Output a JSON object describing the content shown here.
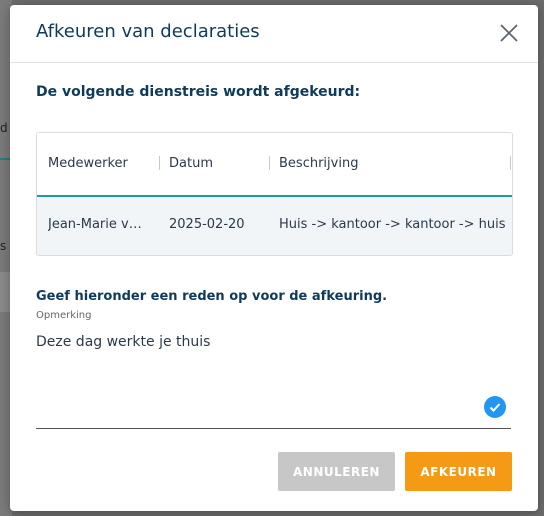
{
  "background": {
    "text1": "d",
    "text2": "s"
  },
  "dialog": {
    "title": "Afkeuren van declaraties",
    "close_icon": "close-icon",
    "subtitle": "De volgende dienstreis wordt afgekeurd:",
    "grid": {
      "columns": [
        "Medewerker",
        "Datum",
        "Beschrijving"
      ],
      "rows": [
        {
          "medewerker": "Jean-Marie va...",
          "datum": "2025-02-20",
          "beschrijving": "Huis -> kantoor -> kantoor -> huis"
        }
      ]
    },
    "reason": {
      "label": "Geef hieronder een reden op voor de afkeuring.",
      "field_label": "Opmerking",
      "value": "Deze dag werkte je thuis",
      "valid_icon": "check-circle-icon"
    },
    "buttons": {
      "cancel": "ANNULEREN",
      "reject": "AFKEUREN"
    }
  },
  "colors": {
    "accent": "#f59a14",
    "title": "#0e3b5a",
    "grid_line": "#1e9aa0",
    "check": "#2196f3"
  }
}
